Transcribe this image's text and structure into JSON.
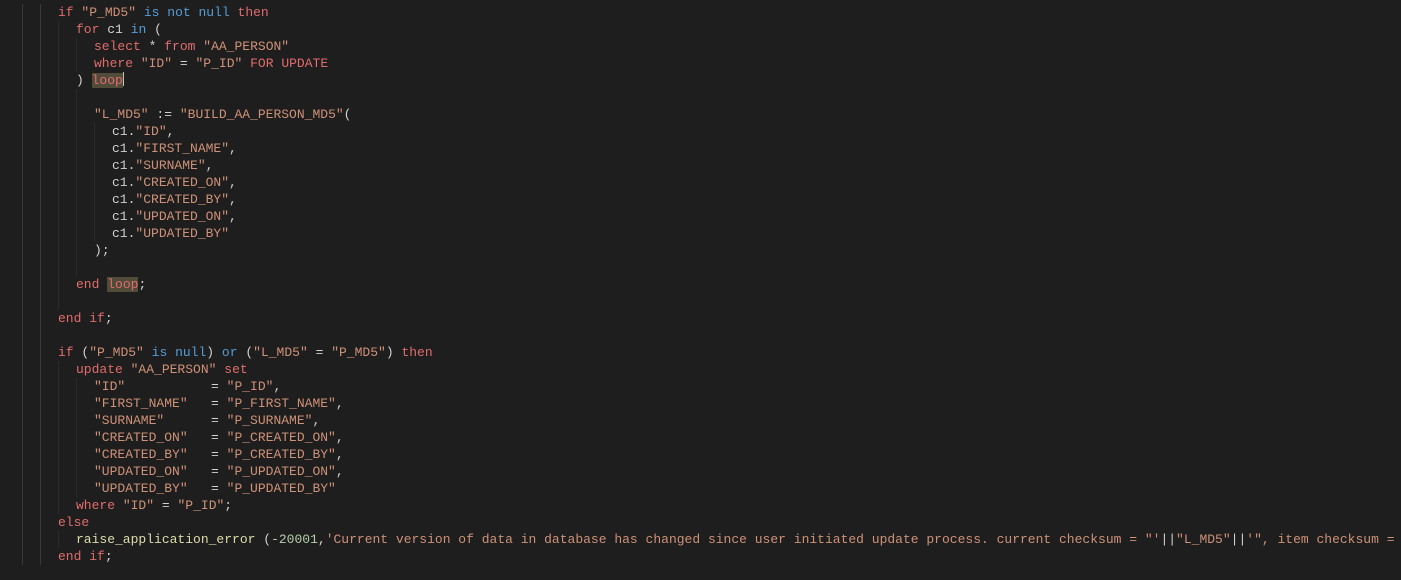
{
  "indent_unit": 18,
  "guide_columns": [
    0,
    1
  ],
  "lines": [
    {
      "indent": 2,
      "guides": [
        1,
        1,
        0,
        0,
        0,
        0
      ],
      "tokens": [
        {
          "cls": "kw",
          "key": "kw.if"
        },
        {
          "text": " "
        },
        {
          "cls": "str",
          "key": "code.q_P_MD5"
        },
        {
          "text": " "
        },
        {
          "cls": "kw2",
          "key": "kw.is"
        },
        {
          "text": " "
        },
        {
          "cls": "kw2",
          "key": "kw.not"
        },
        {
          "text": " "
        },
        {
          "cls": "kw2",
          "key": "kw.null"
        },
        {
          "text": " "
        },
        {
          "cls": "kw",
          "key": "kw.then"
        }
      ]
    },
    {
      "indent": 3,
      "guides": [
        1,
        1,
        1,
        0,
        0,
        0
      ],
      "tokens": [
        {
          "cls": "kw",
          "key": "kw.for"
        },
        {
          "text": " "
        },
        {
          "cls": "id",
          "key": "code.c1"
        },
        {
          "text": " "
        },
        {
          "cls": "kw2",
          "key": "kw.in"
        },
        {
          "text": " "
        },
        {
          "cls": "punct",
          "text": "("
        }
      ]
    },
    {
      "indent": 4,
      "guides": [
        1,
        1,
        1,
        1,
        0,
        0
      ],
      "tokens": [
        {
          "cls": "kw",
          "key": "kw.select"
        },
        {
          "text": " "
        },
        {
          "cls": "punct",
          "text": "*"
        },
        {
          "text": " "
        },
        {
          "cls": "kw",
          "key": "kw.from"
        },
        {
          "text": " "
        },
        {
          "cls": "str",
          "key": "code.q_AA_PERSON"
        }
      ]
    },
    {
      "indent": 4,
      "guides": [
        1,
        1,
        1,
        1,
        0,
        0
      ],
      "tokens": [
        {
          "cls": "kw",
          "key": "kw.where"
        },
        {
          "text": " "
        },
        {
          "cls": "str",
          "key": "code.q_ID"
        },
        {
          "text": " "
        },
        {
          "cls": "punct",
          "text": "="
        },
        {
          "text": " "
        },
        {
          "cls": "str",
          "key": "code.q_P_ID"
        },
        {
          "text": " "
        },
        {
          "cls": "kw",
          "key": "kw.for_update"
        }
      ]
    },
    {
      "indent": 3,
      "guides": [
        1,
        1,
        1,
        0,
        0,
        0
      ],
      "tokens": [
        {
          "cls": "punct",
          "text": ")"
        },
        {
          "text": " "
        },
        {
          "cls": "kw hl",
          "key": "kw.loop"
        },
        {
          "cls": "cursor",
          "text": ""
        }
      ]
    },
    {
      "indent": 3,
      "guides": [
        1,
        1,
        1,
        1,
        0,
        0
      ],
      "tokens": [
        {
          "text": " "
        }
      ]
    },
    {
      "indent": 4,
      "guides": [
        1,
        1,
        1,
        1,
        0,
        0
      ],
      "tokens": [
        {
          "cls": "str",
          "key": "code.q_L_MD5"
        },
        {
          "text": " "
        },
        {
          "cls": "punct",
          "text": ":="
        },
        {
          "text": " "
        },
        {
          "cls": "str",
          "key": "code.q_BUILD_AA_PERSON_MD5"
        },
        {
          "cls": "punct",
          "text": "("
        }
      ]
    },
    {
      "indent": 5,
      "guides": [
        1,
        1,
        1,
        1,
        1,
        0
      ],
      "tokens": [
        {
          "cls": "id",
          "key": "code.c1"
        },
        {
          "cls": "punct",
          "text": "."
        },
        {
          "cls": "str",
          "key": "code.q_ID"
        },
        {
          "cls": "punct",
          "text": ","
        }
      ]
    },
    {
      "indent": 5,
      "guides": [
        1,
        1,
        1,
        1,
        1,
        0
      ],
      "tokens": [
        {
          "cls": "id",
          "key": "code.c1"
        },
        {
          "cls": "punct",
          "text": "."
        },
        {
          "cls": "str",
          "key": "code.q_FIRST_NAME"
        },
        {
          "cls": "punct",
          "text": ","
        }
      ]
    },
    {
      "indent": 5,
      "guides": [
        1,
        1,
        1,
        1,
        1,
        0
      ],
      "tokens": [
        {
          "cls": "id",
          "key": "code.c1"
        },
        {
          "cls": "punct",
          "text": "."
        },
        {
          "cls": "str",
          "key": "code.q_SURNAME"
        },
        {
          "cls": "punct",
          "text": ","
        }
      ]
    },
    {
      "indent": 5,
      "guides": [
        1,
        1,
        1,
        1,
        1,
        0
      ],
      "tokens": [
        {
          "cls": "id",
          "key": "code.c1"
        },
        {
          "cls": "punct",
          "text": "."
        },
        {
          "cls": "str",
          "key": "code.q_CREATED_ON"
        },
        {
          "cls": "punct",
          "text": ","
        }
      ]
    },
    {
      "indent": 5,
      "guides": [
        1,
        1,
        1,
        1,
        1,
        0
      ],
      "tokens": [
        {
          "cls": "id",
          "key": "code.c1"
        },
        {
          "cls": "punct",
          "text": "."
        },
        {
          "cls": "str",
          "key": "code.q_CREATED_BY"
        },
        {
          "cls": "punct",
          "text": ","
        }
      ]
    },
    {
      "indent": 5,
      "guides": [
        1,
        1,
        1,
        1,
        1,
        0
      ],
      "tokens": [
        {
          "cls": "id",
          "key": "code.c1"
        },
        {
          "cls": "punct",
          "text": "."
        },
        {
          "cls": "str",
          "key": "code.q_UPDATED_ON"
        },
        {
          "cls": "punct",
          "text": ","
        }
      ]
    },
    {
      "indent": 5,
      "guides": [
        1,
        1,
        1,
        1,
        1,
        0
      ],
      "tokens": [
        {
          "cls": "id",
          "key": "code.c1"
        },
        {
          "cls": "punct",
          "text": "."
        },
        {
          "cls": "str",
          "key": "code.q_UPDATED_BY"
        }
      ]
    },
    {
      "indent": 4,
      "guides": [
        1,
        1,
        1,
        1,
        0,
        0
      ],
      "tokens": [
        {
          "cls": "punct",
          "text": ")"
        },
        {
          "cls": "punct",
          "text": ";"
        }
      ]
    },
    {
      "indent": 3,
      "guides": [
        1,
        1,
        1,
        1,
        0,
        0
      ],
      "tokens": [
        {
          "text": " "
        }
      ]
    },
    {
      "indent": 3,
      "guides": [
        1,
        1,
        1,
        0,
        0,
        0
      ],
      "tokens": [
        {
          "cls": "kw",
          "key": "kw.end"
        },
        {
          "text": " "
        },
        {
          "cls": "kw hl",
          "key": "kw.loop"
        },
        {
          "cls": "punct",
          "text": ";"
        }
      ]
    },
    {
      "indent": 2,
      "guides": [
        1,
        1,
        1,
        0,
        0,
        0
      ],
      "tokens": [
        {
          "text": " "
        }
      ]
    },
    {
      "indent": 2,
      "guides": [
        1,
        1,
        0,
        0,
        0,
        0
      ],
      "tokens": [
        {
          "cls": "kw",
          "key": "kw.end"
        },
        {
          "text": " "
        },
        {
          "cls": "kw",
          "key": "kw.if"
        },
        {
          "cls": "punct",
          "text": ";"
        }
      ]
    },
    {
      "indent": 2,
      "guides": [
        1,
        1,
        0,
        0,
        0,
        0
      ],
      "tokens": [
        {
          "text": " "
        }
      ]
    },
    {
      "indent": 2,
      "guides": [
        1,
        1,
        0,
        0,
        0,
        0
      ],
      "tokens": [
        {
          "cls": "kw",
          "key": "kw.if"
        },
        {
          "text": " "
        },
        {
          "cls": "punct",
          "text": "("
        },
        {
          "cls": "str",
          "key": "code.q_P_MD5"
        },
        {
          "text": " "
        },
        {
          "cls": "kw2",
          "key": "kw.is"
        },
        {
          "text": " "
        },
        {
          "cls": "kw2",
          "key": "kw.null"
        },
        {
          "cls": "punct",
          "text": ")"
        },
        {
          "text": " "
        },
        {
          "cls": "kw2",
          "key": "kw.or"
        },
        {
          "text": " "
        },
        {
          "cls": "punct",
          "text": "("
        },
        {
          "cls": "str",
          "key": "code.q_L_MD5"
        },
        {
          "text": " "
        },
        {
          "cls": "punct",
          "text": "="
        },
        {
          "text": " "
        },
        {
          "cls": "str",
          "key": "code.q_P_MD5"
        },
        {
          "cls": "punct",
          "text": ")"
        },
        {
          "text": " "
        },
        {
          "cls": "kw",
          "key": "kw.then"
        }
      ]
    },
    {
      "indent": 3,
      "guides": [
        1,
        1,
        1,
        0,
        0,
        0
      ],
      "tokens": [
        {
          "cls": "kw",
          "key": "kw.update"
        },
        {
          "text": " "
        },
        {
          "cls": "str",
          "key": "code.q_AA_PERSON"
        },
        {
          "text": " "
        },
        {
          "cls": "kw",
          "key": "kw.set"
        }
      ]
    },
    {
      "indent": 4,
      "guides": [
        1,
        1,
        1,
        1,
        0,
        0
      ],
      "tokens": [
        {
          "cls": "str",
          "key": "code.col_ID"
        },
        {
          "cls": "punct",
          "text": "= "
        },
        {
          "cls": "str",
          "key": "code.q_P_ID"
        },
        {
          "cls": "punct",
          "text": ","
        }
      ]
    },
    {
      "indent": 4,
      "guides": [
        1,
        1,
        1,
        1,
        0,
        0
      ],
      "tokens": [
        {
          "cls": "str",
          "key": "code.col_FIRST_NAME"
        },
        {
          "cls": "punct",
          "text": "= "
        },
        {
          "cls": "str",
          "key": "code.q_P_FIRST_NAME"
        },
        {
          "cls": "punct",
          "text": ","
        }
      ]
    },
    {
      "indent": 4,
      "guides": [
        1,
        1,
        1,
        1,
        0,
        0
      ],
      "tokens": [
        {
          "cls": "str",
          "key": "code.col_SURNAME"
        },
        {
          "cls": "punct",
          "text": "= "
        },
        {
          "cls": "str",
          "key": "code.q_P_SURNAME"
        },
        {
          "cls": "punct",
          "text": ","
        }
      ]
    },
    {
      "indent": 4,
      "guides": [
        1,
        1,
        1,
        1,
        0,
        0
      ],
      "tokens": [
        {
          "cls": "str",
          "key": "code.col_CREATED_ON"
        },
        {
          "cls": "punct",
          "text": "= "
        },
        {
          "cls": "str",
          "key": "code.q_P_CREATED_ON"
        },
        {
          "cls": "punct",
          "text": ","
        }
      ]
    },
    {
      "indent": 4,
      "guides": [
        1,
        1,
        1,
        1,
        0,
        0
      ],
      "tokens": [
        {
          "cls": "str",
          "key": "code.col_CREATED_BY"
        },
        {
          "cls": "punct",
          "text": "= "
        },
        {
          "cls": "str",
          "key": "code.q_P_CREATED_BY"
        },
        {
          "cls": "punct",
          "text": ","
        }
      ]
    },
    {
      "indent": 4,
      "guides": [
        1,
        1,
        1,
        1,
        0,
        0
      ],
      "tokens": [
        {
          "cls": "str",
          "key": "code.col_UPDATED_ON"
        },
        {
          "cls": "punct",
          "text": "= "
        },
        {
          "cls": "str",
          "key": "code.q_P_UPDATED_ON"
        },
        {
          "cls": "punct",
          "text": ","
        }
      ]
    },
    {
      "indent": 4,
      "guides": [
        1,
        1,
        1,
        1,
        0,
        0
      ],
      "tokens": [
        {
          "cls": "str",
          "key": "code.col_UPDATED_BY"
        },
        {
          "cls": "punct",
          "text": "= "
        },
        {
          "cls": "str",
          "key": "code.q_P_UPDATED_BY"
        }
      ]
    },
    {
      "indent": 3,
      "guides": [
        1,
        1,
        1,
        0,
        0,
        0
      ],
      "tokens": [
        {
          "cls": "kw",
          "key": "kw.where"
        },
        {
          "text": " "
        },
        {
          "cls": "str",
          "key": "code.q_ID"
        },
        {
          "text": " "
        },
        {
          "cls": "punct",
          "text": "="
        },
        {
          "text": " "
        },
        {
          "cls": "str",
          "key": "code.q_P_ID"
        },
        {
          "cls": "punct",
          "text": ";"
        }
      ]
    },
    {
      "indent": 2,
      "guides": [
        1,
        1,
        0,
        0,
        0,
        0
      ],
      "tokens": [
        {
          "cls": "kw",
          "key": "kw.else"
        }
      ]
    },
    {
      "indent": 3,
      "guides": [
        1,
        1,
        1,
        0,
        0,
        0
      ],
      "tokens": [
        {
          "cls": "fn",
          "key": "code.raise_application_error"
        },
        {
          "text": " "
        },
        {
          "cls": "punct",
          "text": "("
        },
        {
          "cls": "num",
          "key": "code.errcode"
        },
        {
          "cls": "punct",
          "text": ","
        },
        {
          "cls": "str",
          "key": "code.errmsg_part1"
        },
        {
          "cls": "punct",
          "text": "||"
        },
        {
          "cls": "str",
          "key": "code.q_L_MD5"
        },
        {
          "cls": "punct",
          "text": "||"
        },
        {
          "cls": "str",
          "key": "code.errmsg_part2"
        },
        {
          "cls": "punct",
          "text": "||"
        },
        {
          "cls": "str",
          "key": "code.q_P_MD5"
        },
        {
          "cls": "punct",
          "text": "||"
        },
        {
          "cls": "str",
          "key": "code.errmsg_part3"
        },
        {
          "cls": "punct",
          "text": ");"
        }
      ]
    },
    {
      "indent": 2,
      "guides": [
        1,
        1,
        0,
        0,
        0,
        0
      ],
      "tokens": [
        {
          "cls": "kw",
          "key": "kw.end"
        },
        {
          "text": " "
        },
        {
          "cls": "kw",
          "key": "kw.if"
        },
        {
          "cls": "punct",
          "text": ";"
        }
      ]
    }
  ],
  "kw": {
    "if": "if",
    "then": "then",
    "for": "for",
    "in": "in",
    "select": "select",
    "from": "from",
    "where": "where",
    "for_update": "FOR UPDATE",
    "loop": "loop",
    "end": "end",
    "update": "update",
    "set": "set",
    "else": "else",
    "is": "is",
    "not": "not",
    "null": "null",
    "or": "or"
  },
  "code": {
    "c1": "c1",
    "q_P_MD5": "\"P_MD5\"",
    "q_L_MD5": "\"L_MD5\"",
    "q_AA_PERSON": "\"AA_PERSON\"",
    "q_ID": "\"ID\"",
    "q_P_ID": "\"P_ID\"",
    "q_FIRST_NAME": "\"FIRST_NAME\"",
    "q_SURNAME": "\"SURNAME\"",
    "q_CREATED_ON": "\"CREATED_ON\"",
    "q_CREATED_BY": "\"CREATED_BY\"",
    "q_UPDATED_ON": "\"UPDATED_ON\"",
    "q_UPDATED_BY": "\"UPDATED_BY\"",
    "q_BUILD_AA_PERSON_MD5": "\"BUILD_AA_PERSON_MD5\"",
    "q_P_FIRST_NAME": "\"P_FIRST_NAME\"",
    "q_P_SURNAME": "\"P_SURNAME\"",
    "q_P_CREATED_ON": "\"P_CREATED_ON\"",
    "q_P_CREATED_BY": "\"P_CREATED_BY\"",
    "q_P_UPDATED_ON": "\"P_UPDATED_ON\"",
    "q_P_UPDATED_BY": "\"P_UPDATED_BY\"",
    "col_ID": "\"ID\"           ",
    "col_FIRST_NAME": "\"FIRST_NAME\"   ",
    "col_SURNAME": "\"SURNAME\"      ",
    "col_CREATED_ON": "\"CREATED_ON\"   ",
    "col_CREATED_BY": "\"CREATED_BY\"   ",
    "col_UPDATED_ON": "\"UPDATED_ON\"   ",
    "col_UPDATED_BY": "\"UPDATED_BY\"   ",
    "raise_application_error": "raise_application_error",
    "errcode": "-20001",
    "errmsg_part1": "'Current version of data in database has changed since user initiated update process. current checksum = \"'",
    "errmsg_part2": "'\", item checksum = \"'",
    "errmsg_part3": "'\".'"
  }
}
